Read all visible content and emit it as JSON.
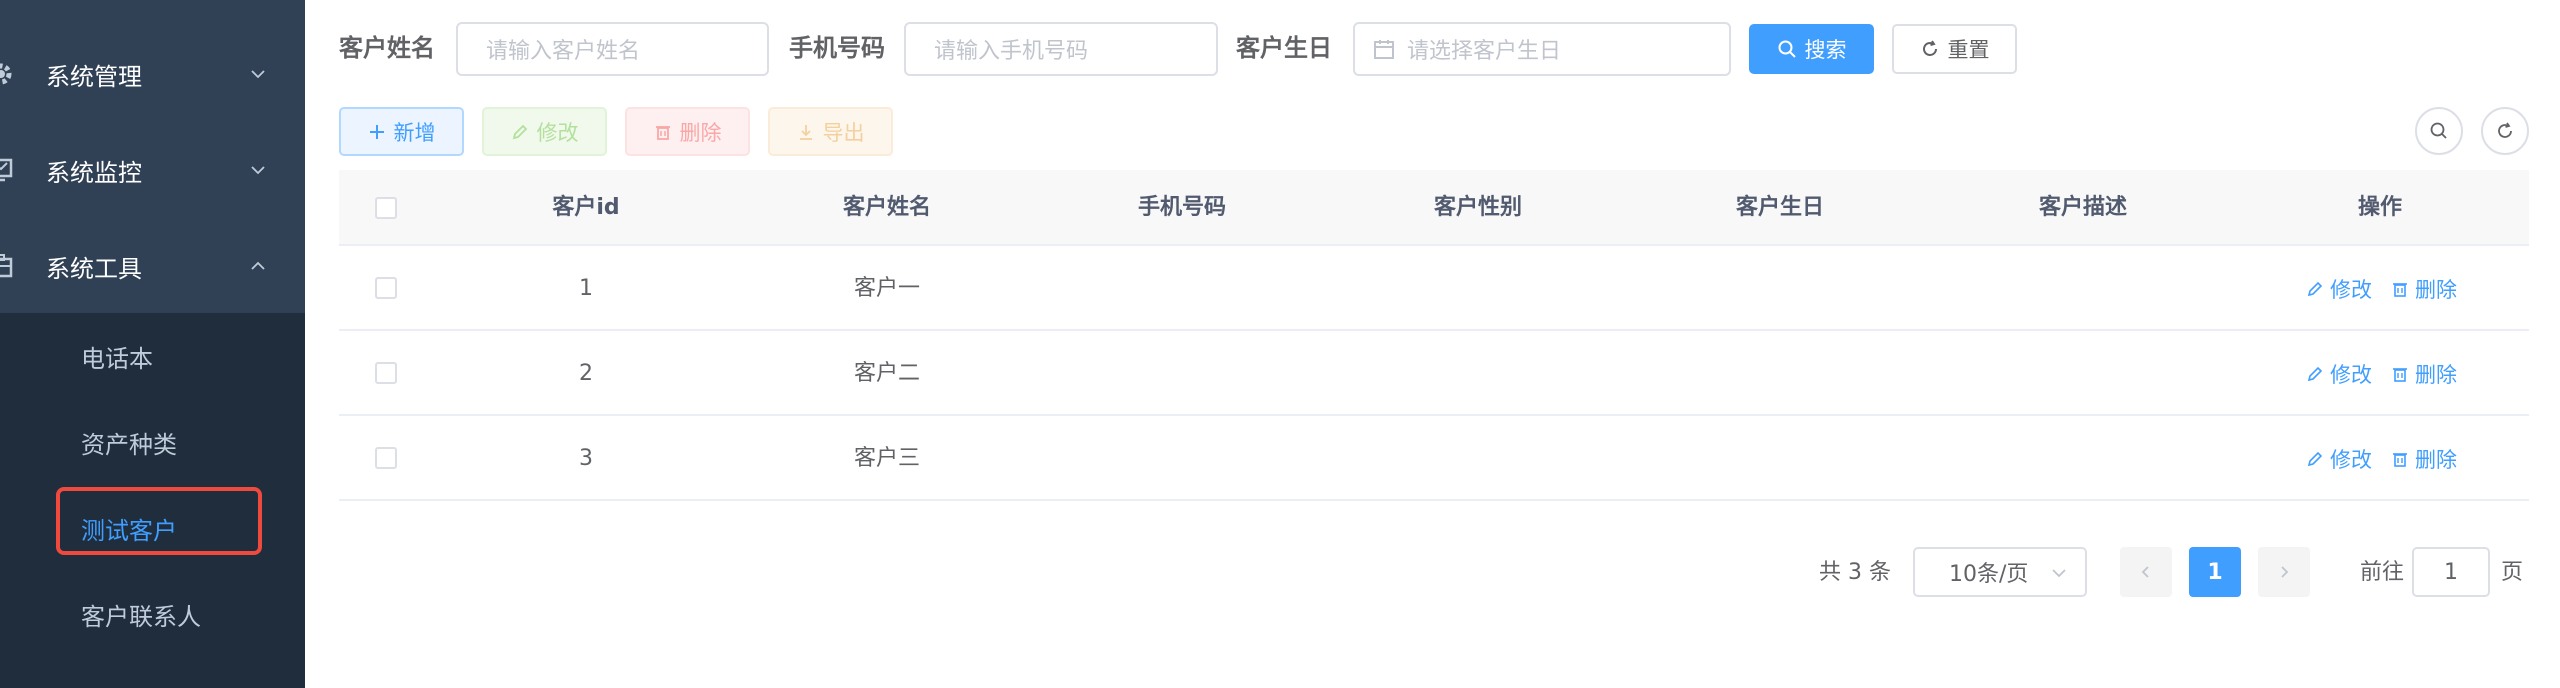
{
  "sidebar": {
    "menus": [
      {
        "label": "系统管理",
        "icon": "gear-icon",
        "expanded": false
      },
      {
        "label": "系统监控",
        "icon": "monitor-icon",
        "expanded": false
      },
      {
        "label": "系统工具",
        "icon": "toolbox-icon",
        "expanded": true
      }
    ],
    "subitems": [
      {
        "label": "电话本",
        "active": false
      },
      {
        "label": "资产种类",
        "active": false
      },
      {
        "label": "测试客户",
        "active": true
      },
      {
        "label": "客户联系人",
        "active": false
      }
    ]
  },
  "search": {
    "name_label": "客户姓名",
    "name_placeholder": "请输入客户姓名",
    "phone_label": "手机号码",
    "phone_placeholder": "请输入手机号码",
    "birthday_label": "客户生日",
    "birthday_placeholder": "请选择客户生日",
    "search_button": "搜索",
    "reset_button": "重置"
  },
  "toolbar": {
    "add": "新增",
    "edit": "修改",
    "delete": "删除",
    "export": "导出"
  },
  "table": {
    "headers": [
      "客户id",
      "客户姓名",
      "手机号码",
      "客户性别",
      "客户生日",
      "客户描述",
      "操作"
    ],
    "rows": [
      {
        "id": "1",
        "name": "客户一",
        "phone": "",
        "gender": "",
        "birthday": "",
        "desc": ""
      },
      {
        "id": "2",
        "name": "客户二",
        "phone": "",
        "gender": "",
        "birthday": "",
        "desc": ""
      },
      {
        "id": "3",
        "name": "客户三",
        "phone": "",
        "gender": "",
        "birthday": "",
        "desc": ""
      }
    ],
    "row_edit": "修改",
    "row_delete": "删除"
  },
  "pagination": {
    "total_text": "共 3 条",
    "page_size": "10条/页",
    "current_page": "1",
    "goto_prefix": "前往",
    "goto_value": "1",
    "goto_suffix": "页"
  },
  "colors": {
    "sidebar_bg": "#304156",
    "submenu_bg": "#1f2d3d",
    "primary": "#409eff",
    "highlight_box": "#f0493d"
  }
}
